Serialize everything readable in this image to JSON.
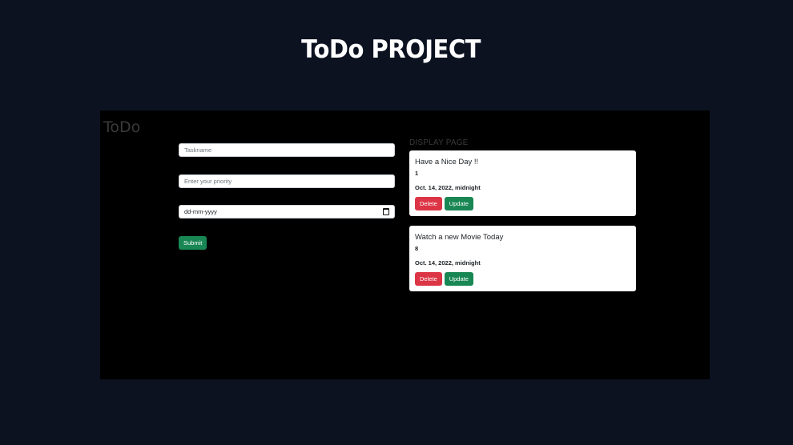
{
  "header": {
    "title": "ToDo PROJECT"
  },
  "panel": {
    "heading": "ToDo"
  },
  "form": {
    "taskname_placeholder": "Taskname",
    "priority_placeholder": "Enter your priority",
    "date_placeholder": "dd-mm-yyyy",
    "submit_label": "Submit"
  },
  "display": {
    "heading": "DISPLAY PAGE",
    "tasks": [
      {
        "name": "Have a Nice Day !!",
        "priority": "1",
        "date": "Oct. 14, 2022, midnight",
        "delete_label": "Delete",
        "update_label": "Update"
      },
      {
        "name": "Watch a new Movie Today",
        "priority": "8",
        "date": "Oct. 14, 2022, midnight",
        "delete_label": "Delete",
        "update_label": "Update"
      }
    ]
  },
  "colors": {
    "page_bg": "#0c1220",
    "panel_bg": "#000000",
    "success": "#198754",
    "danger": "#dc3545"
  },
  "icons": {
    "date_picker": "calendar-icon"
  }
}
